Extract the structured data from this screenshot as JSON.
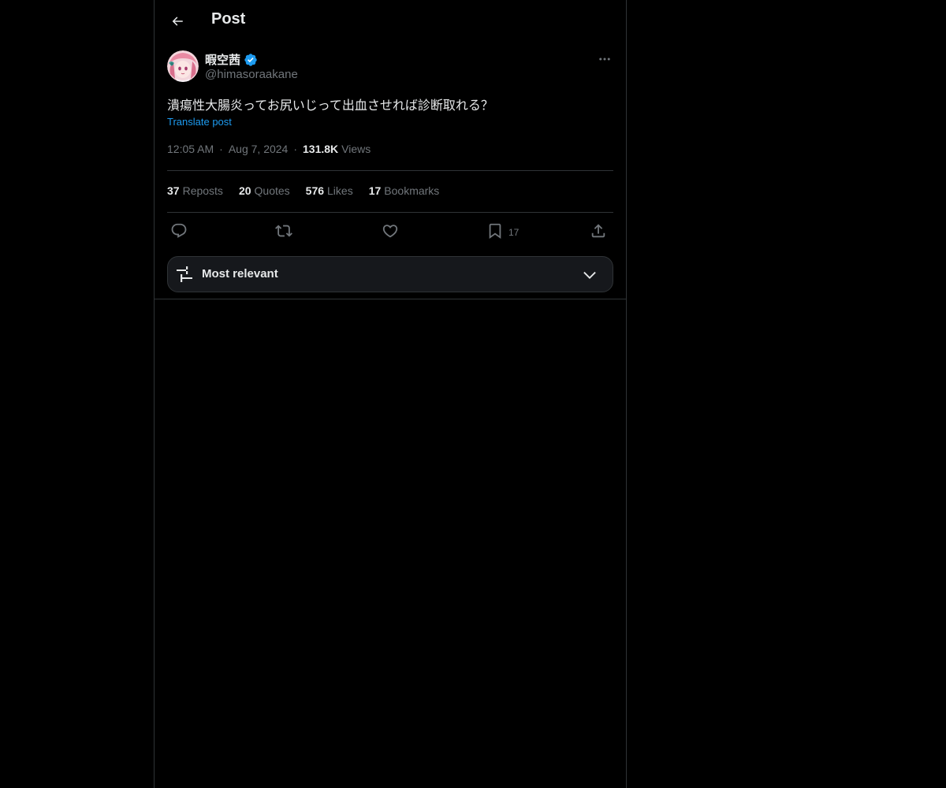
{
  "header": {
    "title": "Post",
    "back_icon": "arrow-left-icon"
  },
  "post": {
    "author": {
      "display_name": "暇空茜",
      "handle": "@himasoraakane",
      "verified": true,
      "avatar_icon": "avatar"
    },
    "text": "潰瘍性大腸炎ってお尻いじって出血させれば診断取れる？",
    "translate_label": "Translate post",
    "time": "12:05 AM",
    "date": "Aug 7, 2024",
    "separator": "·",
    "views_count": "131.8K",
    "views_label": "Views"
  },
  "stats": {
    "reposts": {
      "count": "37",
      "label": "Reposts"
    },
    "quotes": {
      "count": "20",
      "label": "Quotes"
    },
    "likes": {
      "count": "576",
      "label": "Likes"
    },
    "bookmarks": {
      "count": "17",
      "label": "Bookmarks"
    }
  },
  "actions": {
    "reply_icon": "reply-icon",
    "repost_icon": "repost-icon",
    "like_icon": "heart-icon",
    "bookmark_icon": "bookmark-icon",
    "bookmark_count": "17",
    "share_icon": "share-icon"
  },
  "sort": {
    "label": "Most relevant",
    "icon": "sliders-icon",
    "chevron": "chevron-down-icon"
  },
  "colors": {
    "background": "#000000",
    "text": "#e7e9ea",
    "secondary": "#71767b",
    "accent": "#1d9bf0",
    "border": "#2f3336"
  }
}
